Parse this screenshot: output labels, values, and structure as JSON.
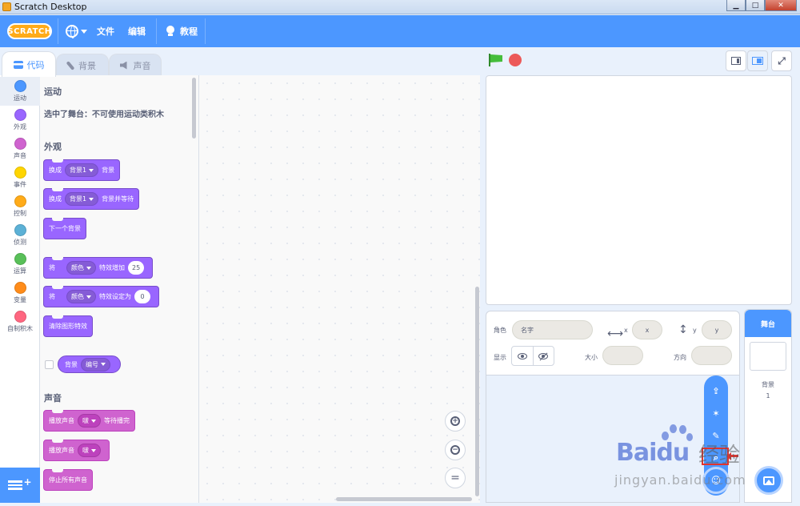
{
  "window": {
    "title": "Scratch Desktop"
  },
  "menubar": {
    "logo": "SCRATCH",
    "file": "文件",
    "edit": "编辑",
    "tutorials": "教程"
  },
  "tabs": [
    {
      "label": "代码"
    },
    {
      "label": "背景"
    },
    {
      "label": "声音"
    }
  ],
  "categories": [
    {
      "label": "运动",
      "color": "#4c97ff"
    },
    {
      "label": "外观",
      "color": "#9966ff"
    },
    {
      "label": "声音",
      "color": "#cf63cf"
    },
    {
      "label": "事件",
      "color": "#ffd500"
    },
    {
      "label": "控制",
      "color": "#ffab19"
    },
    {
      "label": "侦测",
      "color": "#5cb1d6"
    },
    {
      "label": "运算",
      "color": "#59c059"
    },
    {
      "label": "变量",
      "color": "#ff8c1a"
    },
    {
      "label": "自制积木",
      "color": "#ff6680"
    }
  ],
  "palette": {
    "motion_title": "运动",
    "motion_note": "选中了舞台：不可使用运动类积木",
    "looks_title": "外观",
    "looks_blocks": {
      "switch_backdrop": {
        "text": "换成",
        "dd": "背景1",
        "suffix": "背景"
      },
      "switch_backdrop_wait": {
        "text": "换成",
        "dd": "背景1",
        "suffix": "背景并等待"
      },
      "next_backdrop": {
        "text": "下一个背景"
      },
      "change_effect": {
        "text": "将",
        "dd": "颜色",
        "mid": "特效增加",
        "value": "25"
      },
      "set_effect": {
        "text": "将",
        "dd": "颜色",
        "mid": "特效设定为",
        "value": "0"
      },
      "clear_effects": {
        "text": "清除图形特效"
      },
      "backdrop_reporter": {
        "text": "背景",
        "dd": "编号"
      }
    },
    "sound_title": "声音",
    "sound_blocks": {
      "play_until_done": {
        "text": "播放声音",
        "dd": "啵",
        "suffix": "等待播完"
      },
      "start_sound": {
        "text": "播放声音",
        "dd": "啵"
      },
      "stop_all": {
        "text": "停止所有声音"
      }
    }
  },
  "zoom": {
    "zoom_in": "+",
    "zoom_out": "−",
    "reset": "="
  },
  "sprite_info": {
    "sprite_label": "角色",
    "name_placeholder": "名字",
    "x_label": "x",
    "x_placeholder": "x",
    "y_label": "y",
    "y_placeholder": "y",
    "show_label": "显示",
    "size_label": "大小",
    "direction_label": "方向"
  },
  "stage_pane": {
    "title": "舞台",
    "backdrops_label": "背景",
    "backdrops_count": "1"
  },
  "watermark": {
    "brand": "Baidu",
    "suffix": "经验",
    "url": "jingyan.baidu.com"
  },
  "colors": {
    "accent": "#4c97ff",
    "looks": "#9966ff",
    "sound": "#cf63cf",
    "green_flag": "#45bd3b",
    "stop": "#ec5959",
    "annotation_red": "#e0342e"
  }
}
